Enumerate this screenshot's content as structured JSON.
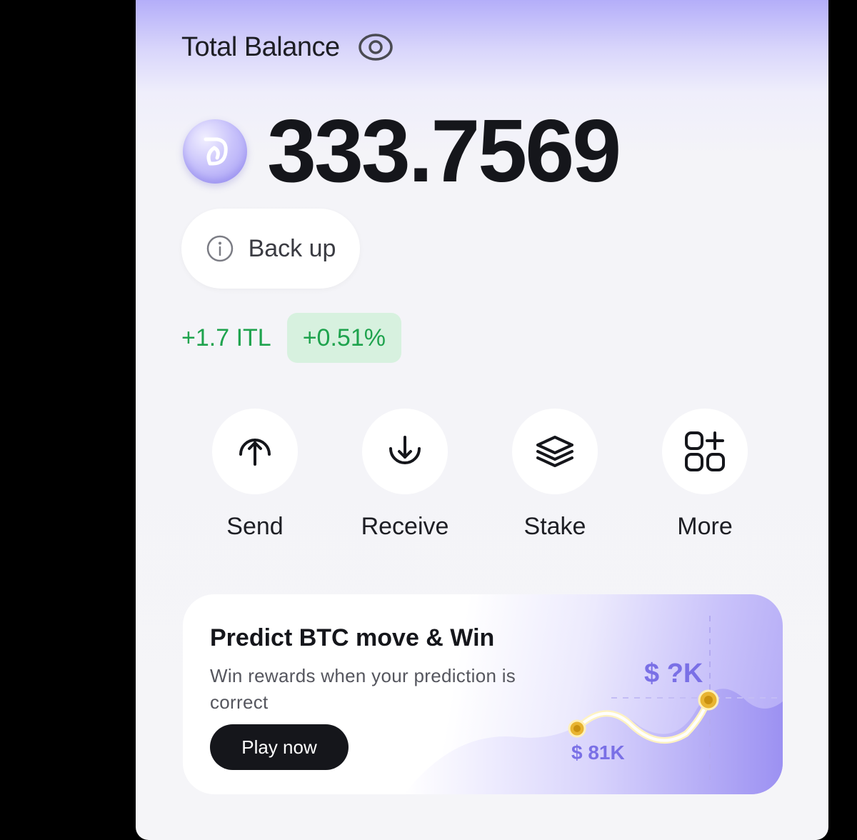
{
  "balance": {
    "title": "Total Balance",
    "value": "333.7569",
    "icons": {
      "visibility": "eye-icon",
      "token": "token-coin-icon"
    }
  },
  "backup": {
    "label": "Back up",
    "icon": "info-icon"
  },
  "change": {
    "amount": "+1.7 ITL",
    "percent": "+0.51%",
    "color": "#1fa34e",
    "badge_bg": "#d7f1df"
  },
  "actions": [
    {
      "label": "Send",
      "icon": "arrow-up-circle-icon"
    },
    {
      "label": "Receive",
      "icon": "arrow-down-circle-icon"
    },
    {
      "label": "Stake",
      "icon": "layers-icon"
    },
    {
      "label": "More",
      "icon": "grid-plus-icon"
    }
  ],
  "promo": {
    "title": "Predict BTC move & Win",
    "description": "Win rewards when your prediction is correct",
    "button_label": "Play now",
    "price_target": "$ ?K",
    "price_current": "$ 81K",
    "accent_color": "#7a70e6"
  },
  "colors": {
    "header_gradient_top": "#b4aef9",
    "background": "#f5f5f8",
    "text_primary": "#15161b"
  }
}
